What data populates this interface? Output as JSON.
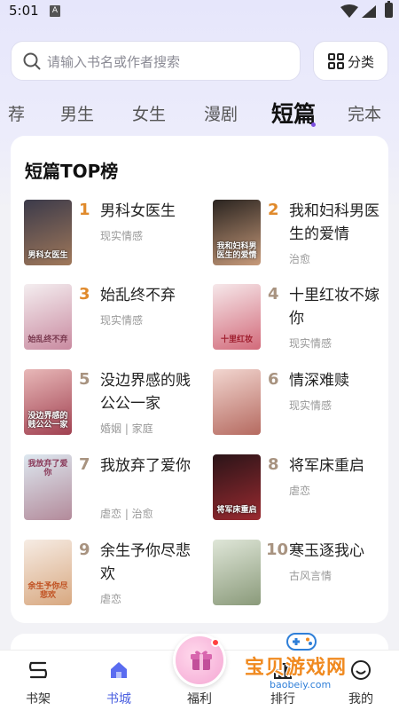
{
  "status_bar": {
    "time": "5:01",
    "sim_label": "A"
  },
  "search": {
    "placeholder": "请输入书名或作者搜索",
    "category_label": "分类"
  },
  "tabs": [
    {
      "label": "荐"
    },
    {
      "label": "男生"
    },
    {
      "label": "女生"
    },
    {
      "label": "漫剧"
    },
    {
      "label": "短篇",
      "active": true
    },
    {
      "label": "完本"
    }
  ],
  "ranking": {
    "title": "短篇TOP榜",
    "books": [
      {
        "rank": "1",
        "title": "男科女医生",
        "tags": "现实情感",
        "cover_text": "男科女医生",
        "cover_colors": [
          "#3b3a4a",
          "#a0785a"
        ]
      },
      {
        "rank": "2",
        "title": "我和妇科男医生的爱情",
        "tags": "治愈",
        "cover_text": "我和妇科男医生的爱情",
        "cover_colors": [
          "#2a2420",
          "#c79a7a"
        ]
      },
      {
        "rank": "3",
        "title": "始乱终不弃",
        "tags": "现实情感",
        "cover_text": "始乱终不弃",
        "cover_colors": [
          "#f4eef0",
          "#c98aa0"
        ]
      },
      {
        "rank": "4",
        "title": "十里红妆不嫁你",
        "tags": "现实情感",
        "cover_text": "十里红妆",
        "cover_colors": [
          "#f6e8ea",
          "#d26a7a"
        ]
      },
      {
        "rank": "5",
        "title": "没边界感的贱公公一家",
        "tags": "婚姻 | 家庭",
        "cover_text": "没边界感的贱公公一家",
        "cover_colors": [
          "#e8b8b8",
          "#a04050"
        ]
      },
      {
        "rank": "6",
        "title": "情深难赎",
        "tags": "现实情感",
        "cover_text": "",
        "cover_colors": [
          "#f2d6d0",
          "#b56a60"
        ]
      },
      {
        "rank": "7",
        "title": "我放弃了爱你",
        "tags": "虐恋 | 治愈",
        "cover_text": "我放弃了爱你",
        "cover_colors": [
          "#dde8f0",
          "#b38a9a"
        ]
      },
      {
        "rank": "8",
        "title": "将军床重启",
        "tags": "虐恋",
        "cover_text": "将军床重启",
        "cover_colors": [
          "#2a1418",
          "#9a2a30"
        ]
      },
      {
        "rank": "9",
        "title": "余生予你尽悲欢",
        "tags": "虐恋",
        "cover_text": "余生予你尽悲欢",
        "cover_colors": [
          "#f6ece4",
          "#d8a880"
        ]
      },
      {
        "rank": "10",
        "title": "寒玉逐我心",
        "tags": "古风言情",
        "cover_text": "",
        "cover_colors": [
          "#dfe6d8",
          "#8a9a7a"
        ]
      }
    ]
  },
  "bottom_nav": [
    {
      "label": "书架",
      "icon": "bookshelf-icon"
    },
    {
      "label": "书城",
      "icon": "bookstore-icon",
      "active": true
    },
    {
      "label": "福利",
      "icon": "gift-icon"
    },
    {
      "label": "排行",
      "icon": "ranking-icon"
    },
    {
      "label": "我的",
      "icon": "profile-icon"
    }
  ],
  "watermark": {
    "text": "宝贝游戏网",
    "url": "baobeiy.com"
  },
  "colors": {
    "accent": "#4a5fe0",
    "rank_top": "#e08a2c",
    "rank_other": "#a89380",
    "tab_dot": "#7d4fe0"
  }
}
